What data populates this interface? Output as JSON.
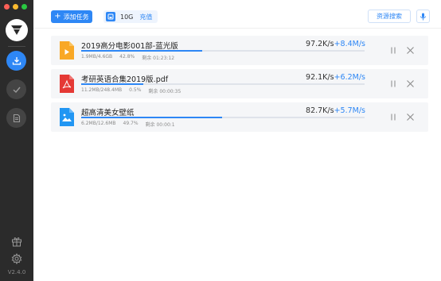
{
  "app": {
    "version": "V2.4.0",
    "colors": {
      "accent": "#2e87f5",
      "sidebar": "#2b2b2b",
      "traffic_red": "#fd5f57",
      "traffic_yellow": "#fdbc2f",
      "traffic_green": "#29c841"
    }
  },
  "sidebar": {
    "logo_icon": "brand-logo-icon",
    "items": [
      {
        "name": "downloading",
        "icon": "download-icon",
        "active": true
      },
      {
        "name": "completed",
        "icon": "check-icon",
        "active": false
      },
      {
        "name": "files",
        "icon": "file-list-icon",
        "active": false
      }
    ],
    "bottom": [
      {
        "name": "gift",
        "icon": "gift-icon"
      },
      {
        "name": "settings",
        "icon": "gear-icon"
      }
    ]
  },
  "toolbar": {
    "add_task_label": "添加任务",
    "disk_size": "10G",
    "recharge_label": "充值",
    "resource_search_label": "资源搜索"
  },
  "tasks": [
    {
      "file_type": "video",
      "icon": "video-file-icon",
      "icon_color": "#f9a825",
      "name": "2019高分电影001部-蓝光版",
      "down_speed": "97.2K/s",
      "up_speed": "+8.4M/s",
      "progress": 0.428,
      "size": "1.9MB/4.6GB",
      "percent": "42.8%",
      "remaining": "剩余 01:23:12"
    },
    {
      "file_type": "pdf",
      "icon": "pdf-file-icon",
      "icon_color": "#e53935",
      "name": "考研英语合集2019版.pdf",
      "down_speed": "92.1K/s",
      "up_speed": "+6.2M/s",
      "progress": 0.22,
      "size": "11.2MB/248.4MB",
      "percent": "0.5%",
      "remaining": "剩余 00:00:35"
    },
    {
      "file_type": "image",
      "icon": "image-file-icon",
      "icon_color": "#2196f3",
      "name": "超高清美女壁纸",
      "down_speed": "82.7K/s",
      "up_speed": "+5.7M/s",
      "progress": 0.497,
      "size": "6.2MB/12.6MB",
      "percent": "49.7%",
      "remaining": "剩余 00:00:1"
    }
  ]
}
